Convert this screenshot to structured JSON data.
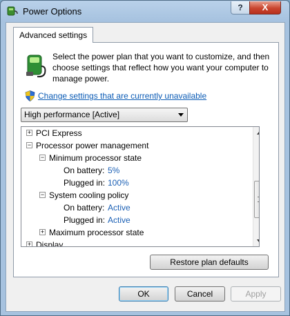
{
  "window": {
    "title": "Power Options",
    "help_label": "?",
    "close_label": "X"
  },
  "tabs": [
    {
      "label": "Advanced settings"
    }
  ],
  "intro_text": "Select the power plan that you want to customize, and then choose settings that reflect how you want your computer to manage power.",
  "change_link": "Change settings that are currently unavailable",
  "plan_select": {
    "value": "High performance [Active]"
  },
  "tree": {
    "rows": [
      {
        "toggle": "+",
        "label": "PCI Express"
      },
      {
        "toggle": "−",
        "label": "Processor power management"
      },
      {
        "toggle": "−",
        "label": "Minimum processor state"
      },
      {
        "label": "On battery:",
        "value": "5%"
      },
      {
        "label": "Plugged in:",
        "value": "100%"
      },
      {
        "toggle": "−",
        "label": "System cooling policy"
      },
      {
        "label": "On battery:",
        "value": "Active"
      },
      {
        "label": "Plugged in:",
        "value": "Active"
      },
      {
        "toggle": "+",
        "label": "Maximum processor state"
      },
      {
        "toggle": "+",
        "label": "Display"
      }
    ]
  },
  "buttons": {
    "restore": "Restore plan defaults",
    "ok": "OK",
    "cancel": "Cancel",
    "apply": "Apply"
  },
  "colors": {
    "link": "#0b5bb5",
    "setting_value": "#1a5fb4",
    "title_bar": "#a6c2df"
  }
}
